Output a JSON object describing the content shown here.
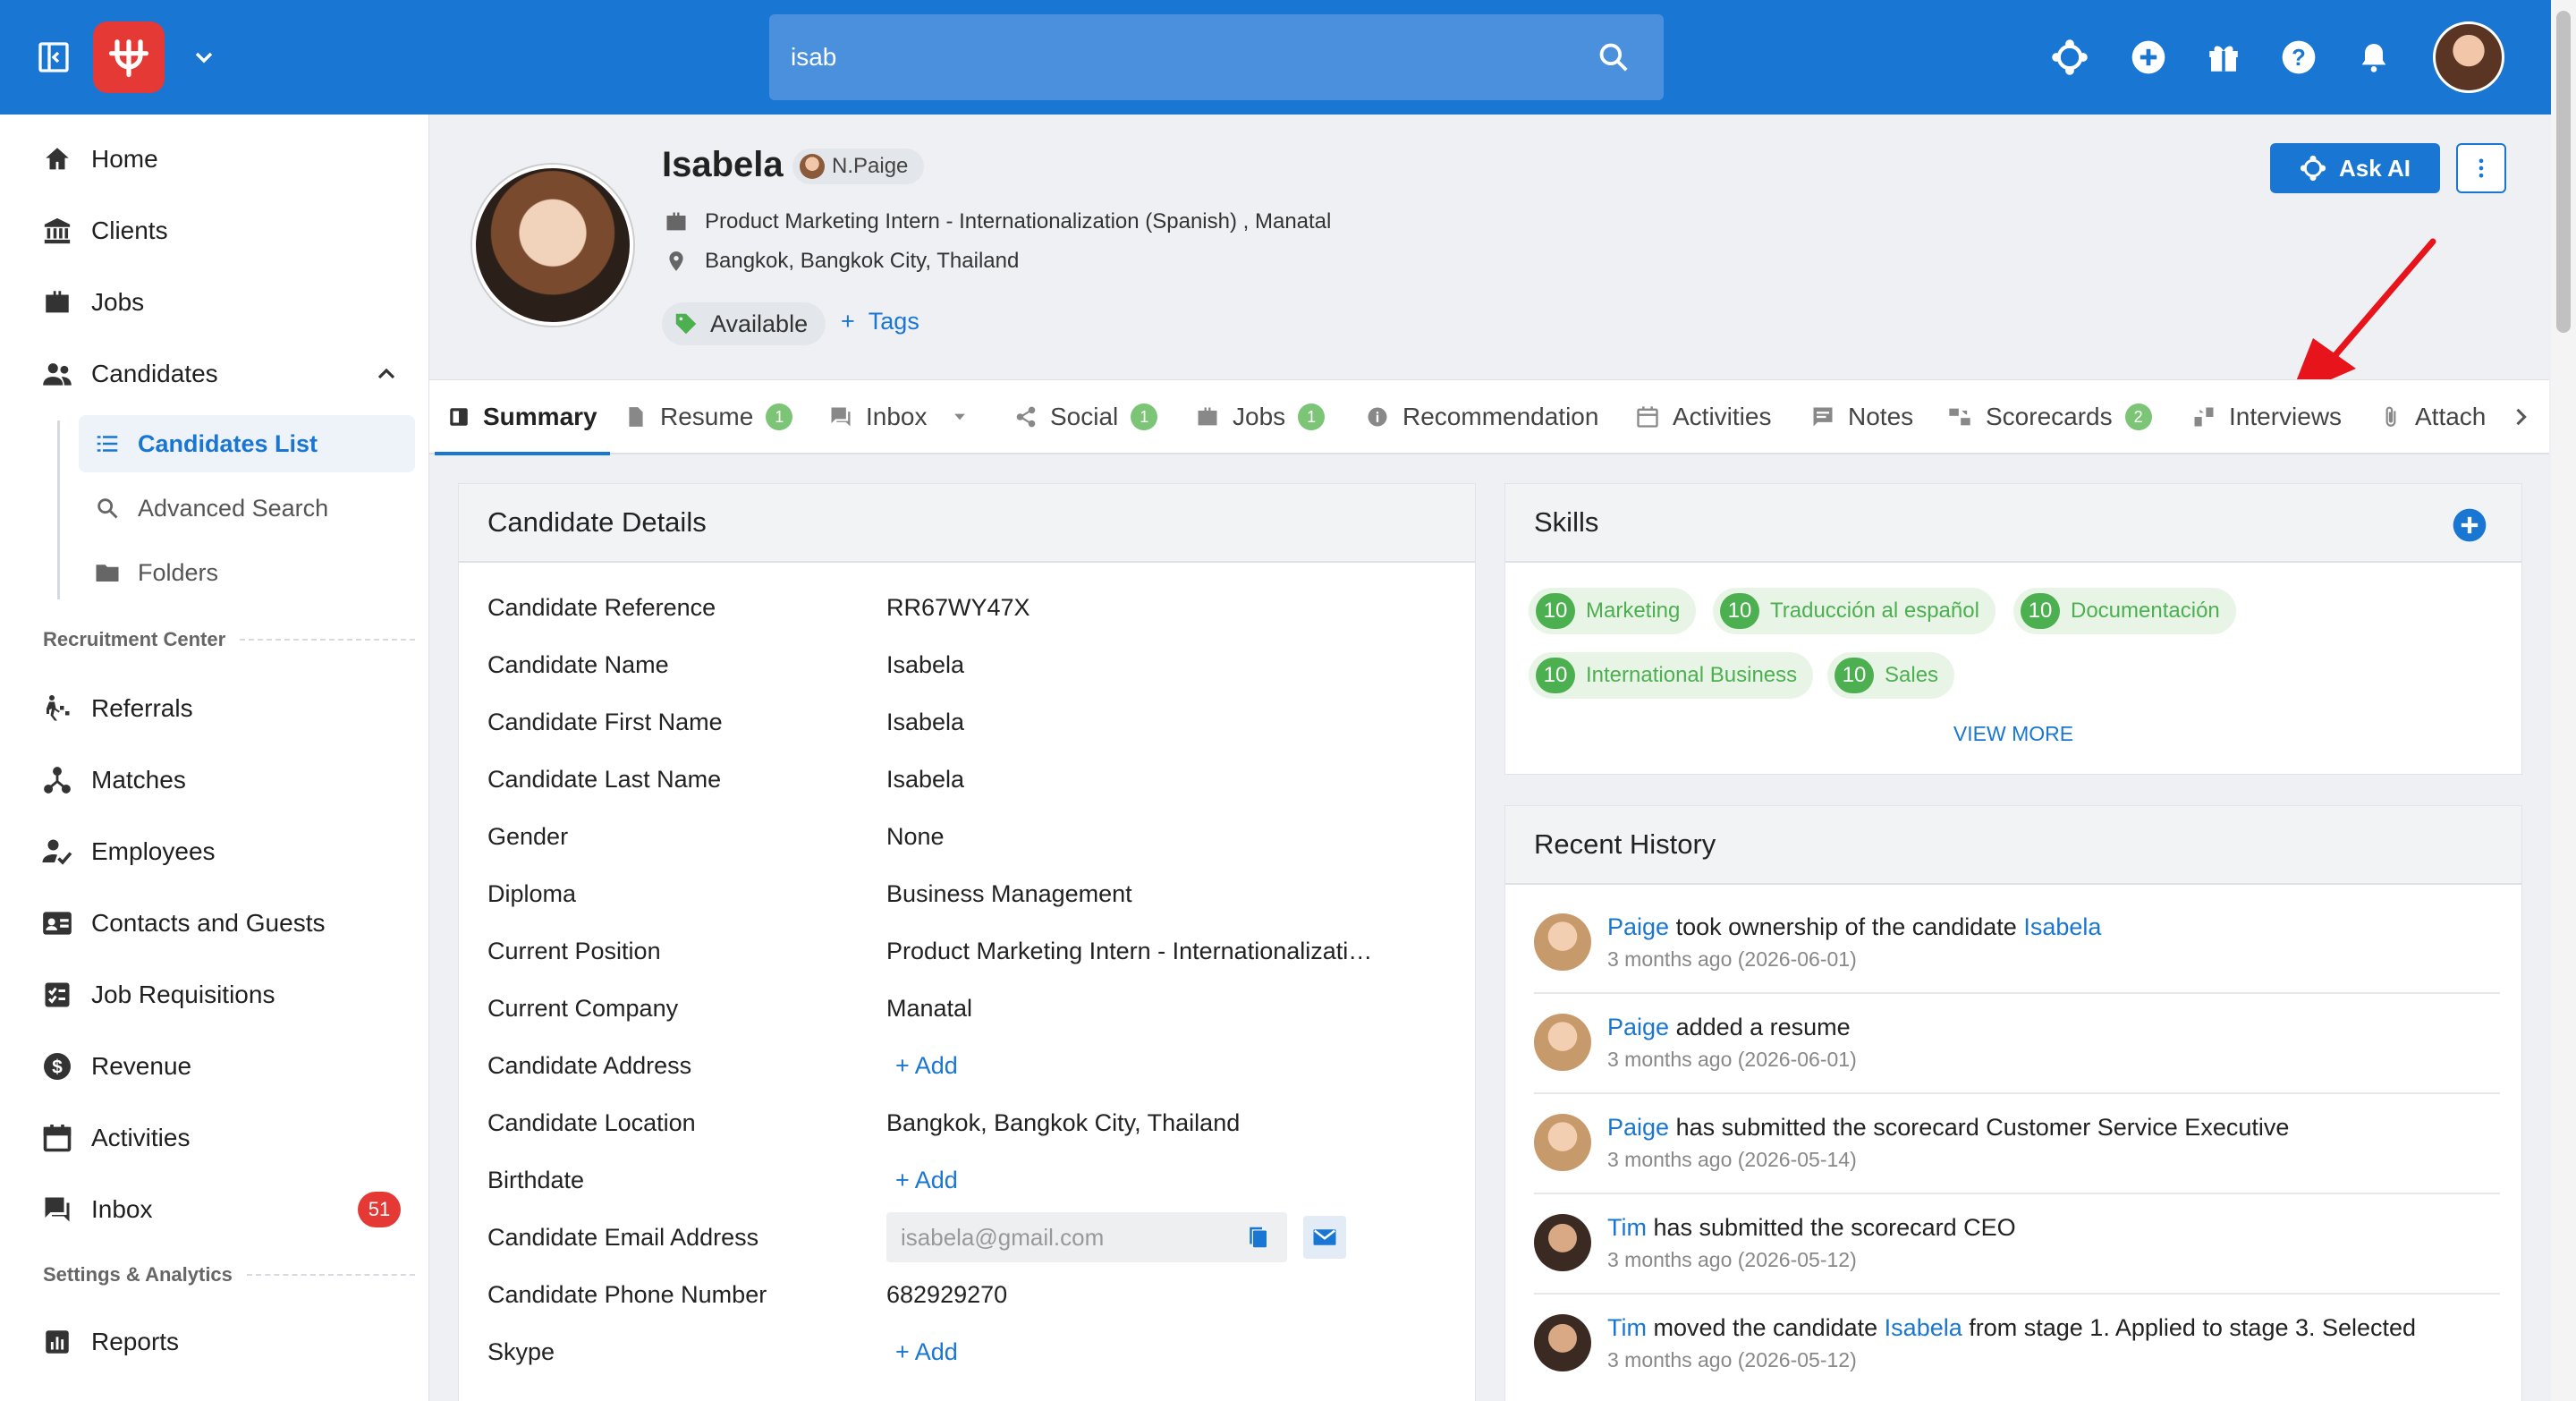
{
  "topbar": {
    "search_value": "isab",
    "icons": [
      "sidebar-toggle-icon",
      "logo",
      "chevron-down-icon",
      "search-icon",
      "ai-icon",
      "add-circle-icon",
      "gift-icon",
      "help-icon",
      "bell-icon"
    ]
  },
  "sidebar": {
    "items": [
      {
        "label": "Home",
        "icon": "home-icon"
      },
      {
        "label": "Clients",
        "icon": "bank-icon"
      },
      {
        "label": "Jobs",
        "icon": "briefcase-icon"
      },
      {
        "label": "Candidates",
        "icon": "people-icon"
      }
    ],
    "sub_items": [
      {
        "label": "Candidates List",
        "icon": "list-icon",
        "active": true
      },
      {
        "label": "Advanced Search",
        "icon": "search-icon"
      },
      {
        "label": "Folders",
        "icon": "folder-icon"
      }
    ],
    "section_recruitment": "Recruitment Center",
    "recruitment_items": [
      {
        "label": "Referrals",
        "icon": "referral-icon"
      },
      {
        "label": "Matches",
        "icon": "hub-icon"
      },
      {
        "label": "Employees",
        "icon": "employee-icon"
      },
      {
        "label": "Contacts and Guests",
        "icon": "contacts-icon"
      },
      {
        "label": "Job Requisitions",
        "icon": "requisition-icon"
      },
      {
        "label": "Revenue",
        "icon": "dollar-icon"
      },
      {
        "label": "Activities",
        "icon": "calendar-icon"
      },
      {
        "label": "Inbox",
        "icon": "inbox-icon",
        "badge": "51"
      }
    ],
    "section_settings": "Settings & Analytics",
    "settings_items": [
      {
        "label": "Reports",
        "icon": "reports-icon"
      }
    ]
  },
  "candidate": {
    "name": "Isabela",
    "owner": "N.Paige",
    "position_line": "Product Marketing Intern - Internationalization (Spanish) , Manatal",
    "location_line": "Bangkok, Bangkok City, Thailand",
    "availability": "Available",
    "tags_label": "Tags",
    "ask_ai_label": "Ask AI"
  },
  "tabs": [
    {
      "label": "Summary",
      "icon": "summary-icon",
      "active": true
    },
    {
      "label": "Resume",
      "icon": "file-icon",
      "count": "1"
    },
    {
      "label": "Inbox",
      "icon": "inbox-icon",
      "dropdown": true
    },
    {
      "label": "Social",
      "icon": "share-icon",
      "count": "1"
    },
    {
      "label": "Jobs",
      "icon": "briefcase-icon",
      "count": "1"
    },
    {
      "label": "Recommendation",
      "icon": "info-icon"
    },
    {
      "label": "Activities",
      "icon": "calendar-icon"
    },
    {
      "label": "Notes",
      "icon": "notes-icon"
    },
    {
      "label": "Scorecards",
      "icon": "scorecard-icon",
      "count": "2"
    },
    {
      "label": "Interviews",
      "icon": "interview-icon"
    },
    {
      "label": "Attach",
      "icon": "attach-icon"
    }
  ],
  "details": {
    "title": "Candidate Details",
    "rows": [
      {
        "label": "Candidate Reference",
        "value": "RR67WY47X"
      },
      {
        "label": "Candidate Name",
        "value": "Isabela"
      },
      {
        "label": "Candidate First Name",
        "value": "Isabela"
      },
      {
        "label": "Candidate Last Name",
        "value": "Isabela"
      },
      {
        "label": "Gender",
        "value": "None"
      },
      {
        "label": "Diploma",
        "value": "Business Management"
      },
      {
        "label": "Current Position",
        "value": "Product Marketing Intern - Internationalizati…"
      },
      {
        "label": "Current Company",
        "value": "Manatal"
      },
      {
        "label": "Candidate Address",
        "value": "+ Add",
        "add": true
      },
      {
        "label": "Candidate Location",
        "value": "Bangkok, Bangkok City, Thailand"
      },
      {
        "label": "Birthdate",
        "value": "+ Add",
        "add": true
      },
      {
        "label": "Candidate Email Address",
        "value": "isabela@gmail.com",
        "email": true
      },
      {
        "label": "Candidate Phone Number",
        "value": "682929270"
      },
      {
        "label": "Skype",
        "value": "+ Add",
        "add": true
      }
    ]
  },
  "skills": {
    "title": "Skills",
    "items": [
      {
        "level": "10",
        "name": "Marketing"
      },
      {
        "level": "10",
        "name": "Traducción al español"
      },
      {
        "level": "10",
        "name": "Documentación"
      },
      {
        "level": "10",
        "name": "International Business"
      },
      {
        "level": "10",
        "name": "Sales"
      }
    ],
    "view_more": "VIEW MORE"
  },
  "history": {
    "title": "Recent History",
    "items": [
      {
        "actor": "Paige",
        "text": " took ownership of the candidate ",
        "target": "Isabela",
        "rest": "",
        "time": "3 months ago (2026-06-01)",
        "avatar": "f"
      },
      {
        "actor": "Paige",
        "text": " added a resume",
        "target": "",
        "rest": "",
        "time": "3 months ago (2026-06-01)",
        "avatar": "f"
      },
      {
        "actor": "Paige",
        "text": " has submitted the scorecard Customer Service Executive",
        "target": "",
        "rest": "",
        "time": "3 months ago (2026-05-14)",
        "avatar": "f"
      },
      {
        "actor": "Tim",
        "text": " has submitted the scorecard CEO",
        "target": "",
        "rest": "",
        "time": "3 months ago (2026-05-12)",
        "avatar": "m"
      },
      {
        "actor": "Tim",
        "text": " moved the candidate ",
        "target": "Isabela",
        "rest": " from stage 1. Applied to stage 3. Selected",
        "time": "3 months ago (2026-05-12)",
        "avatar": "m"
      }
    ]
  },
  "colors": {
    "primary": "#1976d2",
    "danger": "#e53935",
    "success": "#4caf50"
  }
}
